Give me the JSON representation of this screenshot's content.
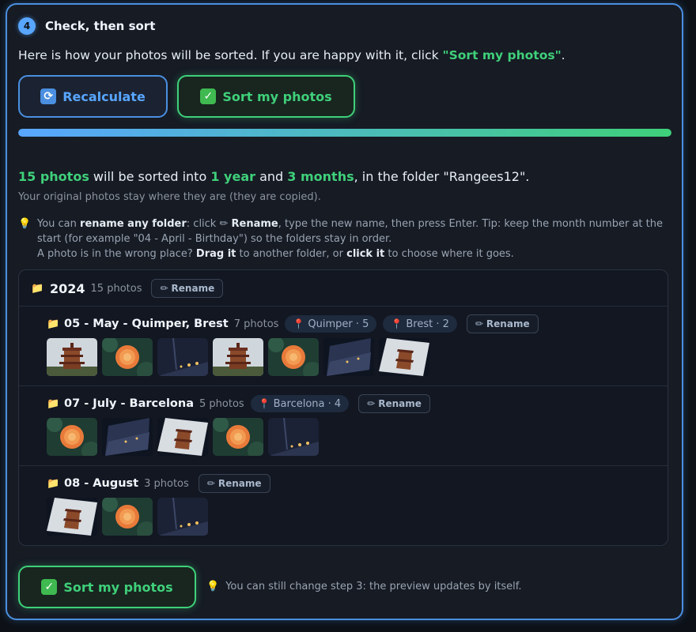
{
  "step": {
    "number": "4",
    "title": "Check, then sort"
  },
  "intro": {
    "before": "Here is how your photos will be sorted. If you are happy with it, click ",
    "highlight": "\"Sort my photos\"",
    "after": "."
  },
  "buttons": {
    "recalculate": "Recalculate",
    "sort": "Sort my photos"
  },
  "progress": {
    "percent": 100
  },
  "summary": {
    "photos": "15 photos",
    "t1": " will be sorted into ",
    "years": "1 year",
    "t2": " and ",
    "months": "3 months",
    "t3": ", in the folder \"Rangees12\".",
    "sub": "Your original photos stay where they are (they are copied)."
  },
  "tip": {
    "p1": "You can ",
    "b1": "rename any folder",
    "p2": ": click ✏ ",
    "b2": "Rename",
    "p3": ", type the new name, then press Enter. Tip: keep the month number at the start (for example \"04 - April - Birthday\") so the folders stay in order.",
    "p4": "A photo is in the wrong place? ",
    "b3": "Drag it",
    "p5": " to another folder, or ",
    "b4": "click it",
    "p6": " to choose where it goes."
  },
  "rename_label": "Rename",
  "tree": {
    "year": "2024",
    "year_count": "15 photos",
    "months": [
      {
        "name": "05 - May - Quimper, Brest",
        "count": "7 photos",
        "locations": [
          "Quimper · 5",
          "Brest · 2"
        ],
        "thumbs": [
          "pagoda",
          "dahlia",
          "night-street",
          "pagoda",
          "dahlia",
          "street-tilted",
          "pagoda-tilted"
        ]
      },
      {
        "name": "07 - July - Barcelona",
        "count": "5 photos",
        "locations": [
          "Barcelona · 4"
        ],
        "thumbs": [
          "dahlia",
          "street-tilted",
          "pagoda-tilted",
          "dahlia",
          "night-street"
        ]
      },
      {
        "name": "08 - August",
        "count": "3 photos",
        "locations": [],
        "thumbs": [
          "pagoda-tilted",
          "dahlia",
          "night-street"
        ]
      }
    ]
  },
  "footer": {
    "button": "Sort my photos",
    "note": "You can still change step 3: the preview updates by itself."
  },
  "colors": {
    "accent_blue": "#58a6ff",
    "accent_green": "#3fd07a"
  }
}
